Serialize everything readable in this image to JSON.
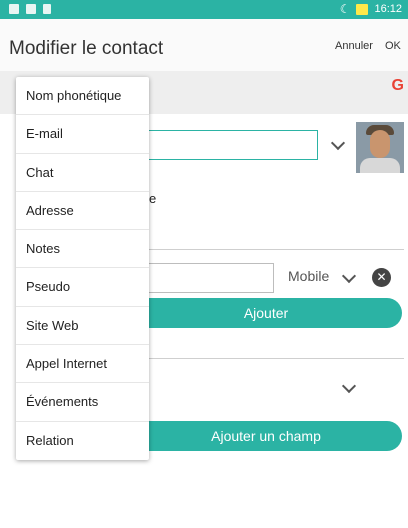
{
  "status_bar": {
    "time": "16:12",
    "moon_icon": "moon-icon",
    "battery_icon": "battery-icon"
  },
  "header": {
    "title": "Modifier le contact",
    "cancel_label": "Annuler",
    "ok_label": "OK"
  },
  "account": {
    "google_icon": "G"
  },
  "partial_label": "e",
  "phone": {
    "type_label": "Mobile",
    "clear_icon": "✕"
  },
  "buttons": {
    "add_label": "Ajouter",
    "add_field_label": "Ajouter un champ"
  },
  "menu": {
    "items": [
      "Nom phonétique",
      "E-mail",
      "Chat",
      "Adresse",
      "Notes",
      "Pseudo",
      "Site Web",
      "Appel Internet",
      "Événements",
      "Relation"
    ]
  },
  "colors": {
    "accent": "#2bb3a4",
    "status_bar": "#2bb3a4",
    "battery": "#ffe94a"
  }
}
